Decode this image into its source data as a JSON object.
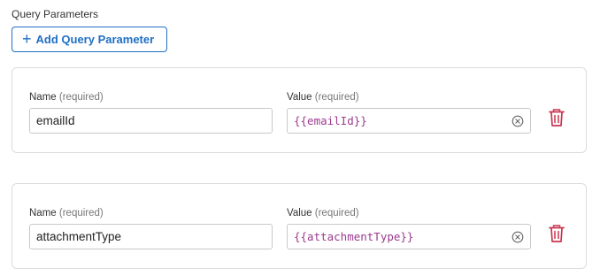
{
  "section": {
    "title": "Query Parameters",
    "add_button_label": "Add Query Parameter"
  },
  "params": [
    {
      "name_label": "Name",
      "name_required": "(required)",
      "value_label": "Value",
      "value_required": "(required)",
      "name": "emailId",
      "value": "{{emailId}}"
    },
    {
      "name_label": "Name",
      "name_required": "(required)",
      "value_label": "Value",
      "value_required": "(required)",
      "name": "attachmentType",
      "value": "{{attachmentType}}"
    }
  ],
  "icons": {
    "add": "plus-icon",
    "clear": "clear-circle-x-icon",
    "delete": "trash-icon"
  },
  "colors": {
    "accent": "#1f6fc4",
    "value_text": "#9c3a8e",
    "delete": "#c8344f"
  }
}
